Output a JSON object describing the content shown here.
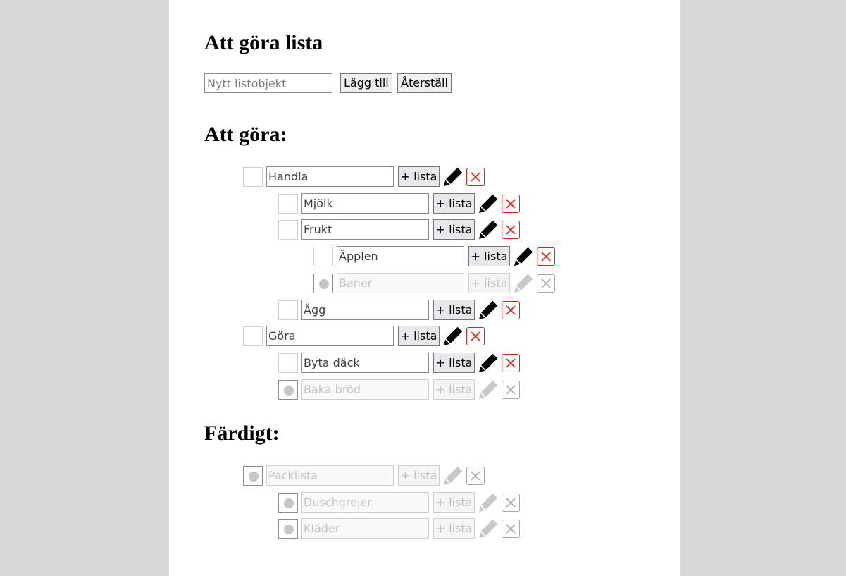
{
  "app": {
    "title": "Att göra lista"
  },
  "form": {
    "input_value": "",
    "input_placeholder": "Nytt listobjekt",
    "add_label": "Lägg till",
    "reset_label": "Återställ"
  },
  "todo_section": {
    "title": "Att göra:"
  },
  "done_section": {
    "title": "Färdigt:"
  },
  "item_actions": {
    "add_sublist_label": "+ lista"
  },
  "icons": {
    "edit": "pencil-icon",
    "delete": "close-icon",
    "done_marker": "filled-circle"
  },
  "colors": {
    "delete": "#dd1f1f",
    "disabled": "#c2c2c2"
  },
  "todo_items": [
    {
      "text": "Handla",
      "level": 0,
      "done": false
    },
    {
      "text": "Mjölk",
      "level": 1,
      "done": false
    },
    {
      "text": "Frukt",
      "level": 1,
      "done": false
    },
    {
      "text": "Äpplen",
      "level": 2,
      "done": false
    },
    {
      "text": "Baner",
      "level": 2,
      "done": true
    },
    {
      "text": "Ägg",
      "level": 1,
      "done": false
    },
    {
      "text": "Göra",
      "level": 0,
      "done": false
    },
    {
      "text": "Byta däck",
      "level": 1,
      "done": false
    },
    {
      "text": "Baka bröd",
      "level": 1,
      "done": true
    }
  ],
  "done_items": [
    {
      "text": "Packlista",
      "level": 0,
      "done": true
    },
    {
      "text": "Duschgrejer",
      "level": 1,
      "done": true
    },
    {
      "text": "Kläder",
      "level": 1,
      "done": true
    }
  ]
}
